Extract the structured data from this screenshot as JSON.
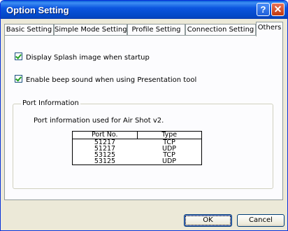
{
  "window": {
    "title": "Option Setting"
  },
  "titlebar": {
    "help_glyph": "?",
    "close_glyph": "✕"
  },
  "tabs": [
    {
      "label": "Basic Setting",
      "active": false
    },
    {
      "label": "Simple Mode Setting",
      "active": false
    },
    {
      "label": "Profile Setting",
      "active": false
    },
    {
      "label": "Connection Setting",
      "active": false
    },
    {
      "label": "Others",
      "active": true
    }
  ],
  "options": {
    "splash": {
      "label": "Display Splash image when startup",
      "checked": true
    },
    "beep": {
      "label": "Enable beep sound when using Presentation tool",
      "checked": true
    }
  },
  "port_info": {
    "group_label": "Port Information",
    "description": "Port information used for Air Shot v2.",
    "columns": [
      "Port No.",
      "Type"
    ],
    "rows": [
      [
        "51217",
        "TCP"
      ],
      [
        "51217",
        "UDP"
      ],
      [
        "53125",
        "TCP"
      ],
      [
        "53125",
        "UDP"
      ]
    ]
  },
  "buttons": {
    "ok": "OK",
    "cancel": "Cancel"
  },
  "colors": {
    "titlebar": "#0348c7",
    "accent_check": "#21a121",
    "dialog_bg": "#ece9d8"
  }
}
